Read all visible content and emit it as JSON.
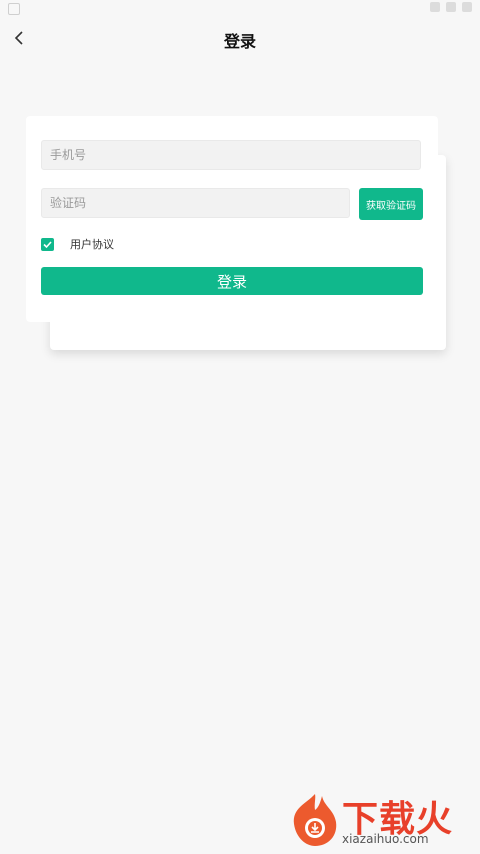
{
  "header": {
    "title": "登录",
    "back_icon": "chevron-left-icon"
  },
  "form": {
    "phone_placeholder": "手机号",
    "phone_value": "",
    "code_placeholder": "验证码",
    "code_value": "",
    "get_code_label": "获取验证码",
    "agreement_label": "用户协议",
    "agreement_checked": true,
    "login_label": "登录"
  },
  "watermark": {
    "title": "下载火",
    "subtitle": "xiazaihuo.com"
  },
  "colors": {
    "accent": "#10b88c",
    "background": "#f7f7f7",
    "card": "#ffffff",
    "watermark": "#e8402a"
  }
}
